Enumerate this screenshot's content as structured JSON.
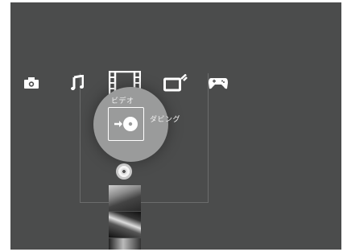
{
  "xmb": {
    "categories": [
      {
        "name": "photo",
        "icon": "camera-icon"
      },
      {
        "name": "music",
        "icon": "music-note-icon"
      },
      {
        "name": "video",
        "icon": "film-strip-icon"
      },
      {
        "name": "tv",
        "icon": "tv-icon"
      },
      {
        "name": "game",
        "icon": "gamepad-icon"
      }
    ],
    "selected_category_label": "ビデオ",
    "selected_item_label": "ダビング",
    "selected_item_icon": "dubbing-disc-icon"
  },
  "colors": {
    "background": "#4b4c4c",
    "focus_circle": "#9a9b9b",
    "icon": "#ffffff"
  }
}
